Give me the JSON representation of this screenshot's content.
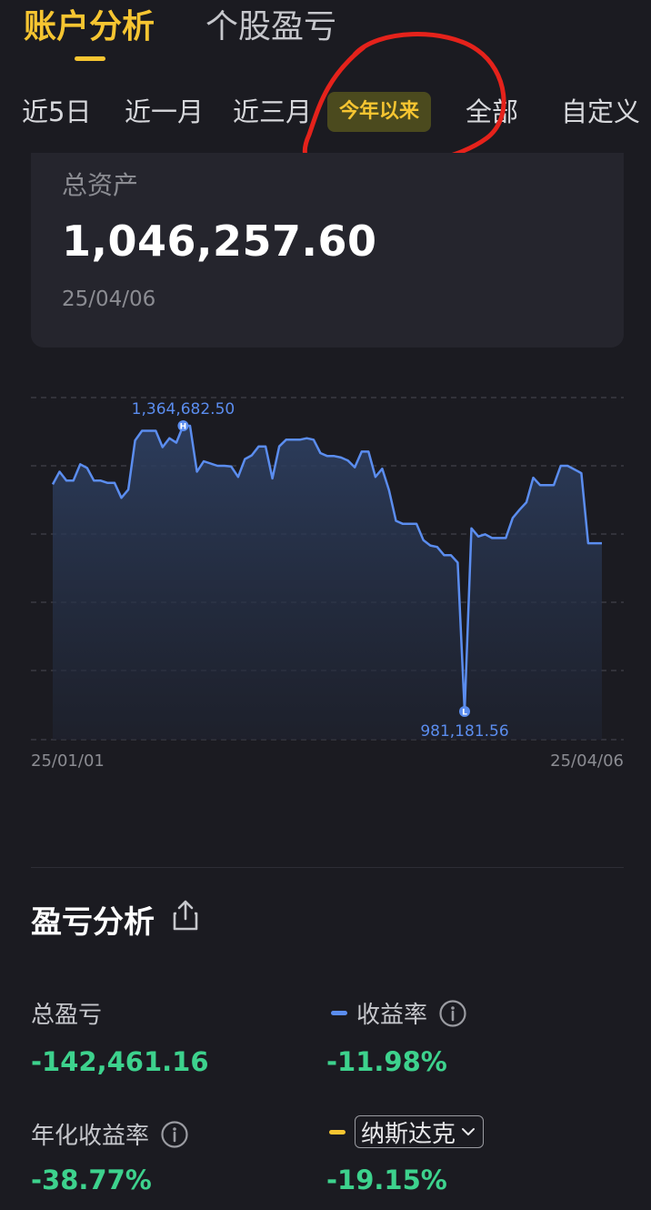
{
  "top_tabs": [
    {
      "label": "账户分析",
      "active": true
    },
    {
      "label": "个股盈亏",
      "active": false
    }
  ],
  "periods": [
    "近5日",
    "近一月",
    "近三月",
    "今年以来",
    "全部",
    "自定义"
  ],
  "selected_period": "今年以来",
  "asset": {
    "label": "总资产",
    "value": "1,046,257.60",
    "date": "25/04/06"
  },
  "chart": {
    "start_label": "25/01/01",
    "end_label": "25/04/06",
    "high_label": "1,364,682.50",
    "low_label": "981,181.56",
    "high_marker": "H",
    "low_marker": "L",
    "line_color": "#5b8def",
    "min_value": 981181.56,
    "max_value": 1364682.5,
    "values": [
      1286000,
      1303000,
      1291000,
      1291000,
      1313000,
      1308000,
      1291000,
      1291000,
      1288000,
      1288000,
      1268000,
      1279000,
      1345000,
      1358000,
      1358000,
      1358000,
      1336000,
      1348000,
      1342000,
      1364682.5,
      1364682.5,
      1303000,
      1317000,
      1314000,
      1311000,
      1311000,
      1310000,
      1296000,
      1320000,
      1325000,
      1337000,
      1337000,
      1294000,
      1337000,
      1346000,
      1346000,
      1346000,
      1348000,
      1346000,
      1328000,
      1324000,
      1324000,
      1322000,
      1318000,
      1309000,
      1330000,
      1330000,
      1296000,
      1307000,
      1278000,
      1237000,
      1233000,
      1233000,
      1233000,
      1211000,
      1204000,
      1202000,
      1191000,
      1191000,
      1181000,
      981181.56,
      1227000,
      1216000,
      1219000,
      1214000,
      1214000,
      1214000,
      1241000,
      1252000,
      1262000,
      1295000,
      1285000,
      1285000,
      1285000,
      1311000,
      1311000,
      1306000,
      1301000,
      1207000,
      1207000,
      1207000
    ],
    "high_index": 19,
    "low_index": 60
  },
  "pnl": {
    "title": "盈亏分析",
    "total_pnl_label": "总盈亏",
    "total_pnl_value": "-142,461.16",
    "return_label": "收益率",
    "return_value": "-11.98%",
    "return_color": "#5b8def",
    "annualized_label": "年化收益率",
    "annualized_value": "-38.77%",
    "benchmark_label": "纳斯达克",
    "benchmark_value": "-19.15%",
    "benchmark_color": "#f6c531",
    "value_color": "#3dd28d"
  }
}
